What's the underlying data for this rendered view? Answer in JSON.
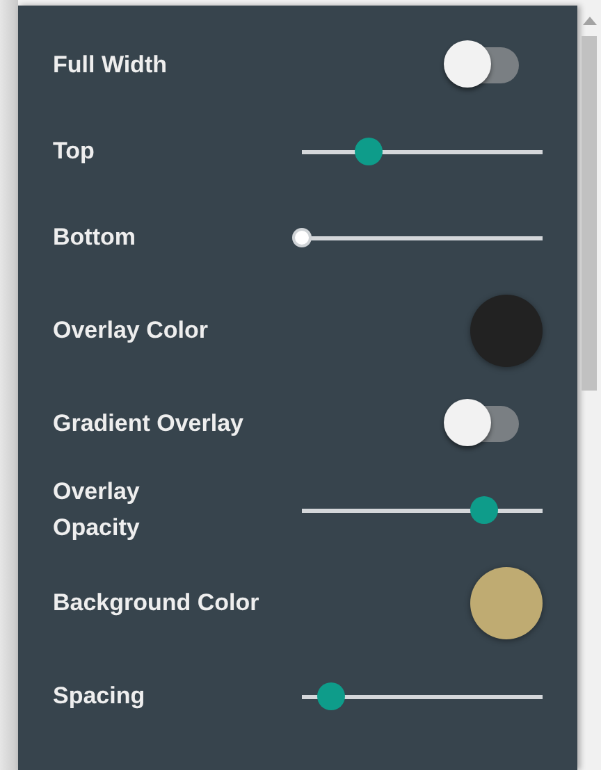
{
  "settings": [
    {
      "kind": "toggle",
      "label": "Full Width",
      "on": false
    },
    {
      "kind": "slider",
      "label": "Top",
      "level": 0.28
    },
    {
      "kind": "slider",
      "label": "Bottom",
      "level": 0
    },
    {
      "kind": "color",
      "label": "Overlay Color",
      "color": "#222222"
    },
    {
      "kind": "toggle",
      "label": "Gradient Overlay",
      "on": false
    },
    {
      "kind": "slider",
      "label": "Overlay Opacity",
      "level": 0.76
    },
    {
      "kind": "color",
      "label": "Background Color",
      "color": "#bfab72"
    },
    {
      "kind": "slider",
      "label": "Spacing",
      "level": 0.12
    }
  ]
}
